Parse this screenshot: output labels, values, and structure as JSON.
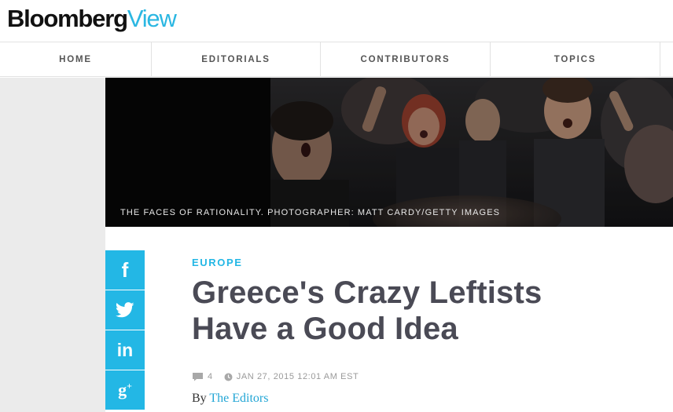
{
  "brand": {
    "name_main": "Bloomberg",
    "name_accent": "View",
    "accent_color": "#2bb7e2"
  },
  "nav": {
    "items": [
      {
        "label": "HOME"
      },
      {
        "label": "EDITORIALS"
      },
      {
        "label": "CONTRIBUTORS"
      },
      {
        "label": "TOPICS"
      }
    ]
  },
  "hero": {
    "caption": "THE FACES OF RATIONALITY. PHOTOGRAPHER: MATT CARDY/GETTY IMAGES"
  },
  "share": {
    "color": "#23b7e5",
    "icons": [
      "facebook-icon",
      "twitter-icon",
      "linkedin-icon",
      "google-plus-icon"
    ]
  },
  "article": {
    "kicker": "EUROPE",
    "headline_line1": "Greece's Crazy Leftists",
    "headline_line2": "Have a Good Idea",
    "comment_count": "4",
    "date": "JAN 27, 2015 12:01 AM EST",
    "byline_prefix": "By",
    "author": "The Editors"
  }
}
